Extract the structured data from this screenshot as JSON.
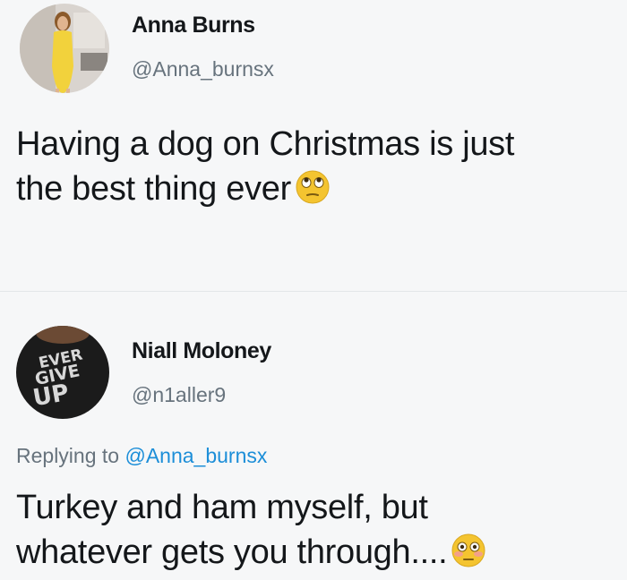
{
  "tweets": [
    {
      "display_name": "Anna Burns",
      "handle": "@Anna_burnsx",
      "text_line1": "Having a dog on Christmas is just",
      "text_line2": "the best thing ever",
      "emoji": "face-with-rolling-eyes-icon"
    },
    {
      "display_name": "Niall Moloney",
      "handle": "@n1aller9",
      "reply_prefix": "Replying to ",
      "reply_mention": "@Anna_burnsx",
      "text_line1": "Turkey and ham myself, but",
      "text_line2": "whatever gets you through....",
      "emoji": "flushed-face-icon",
      "avatar_text": [
        "EVER",
        "GIVE",
        "UP"
      ]
    }
  ],
  "colors": {
    "background": "#f6f7f8",
    "text": "#14171a",
    "secondary_text": "#67737d",
    "mention": "#1c8ed8",
    "emoji_yellow": "#f4c430"
  }
}
